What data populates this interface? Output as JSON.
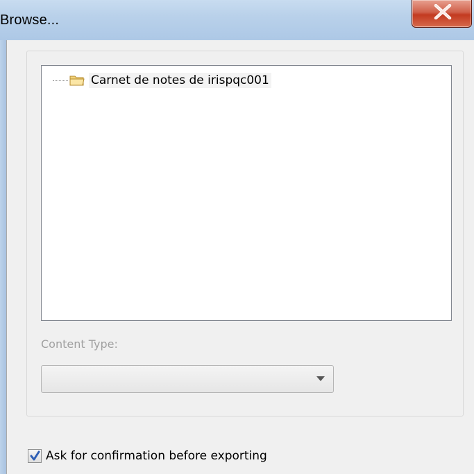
{
  "window": {
    "title": "Browse..."
  },
  "tree": {
    "items": [
      {
        "label": "Carnet de notes de irispqc001",
        "icon": "folder-icon"
      }
    ]
  },
  "content_type": {
    "label": "Content Type:",
    "selected_value": ""
  },
  "options": {
    "confirm_export_label": "Ask for confirmation before exporting",
    "confirm_export_checked": true
  },
  "colors": {
    "close_button": "#c33a20",
    "checkmark": "#2f5fb5",
    "disabled_text": "#a0a0a0"
  }
}
